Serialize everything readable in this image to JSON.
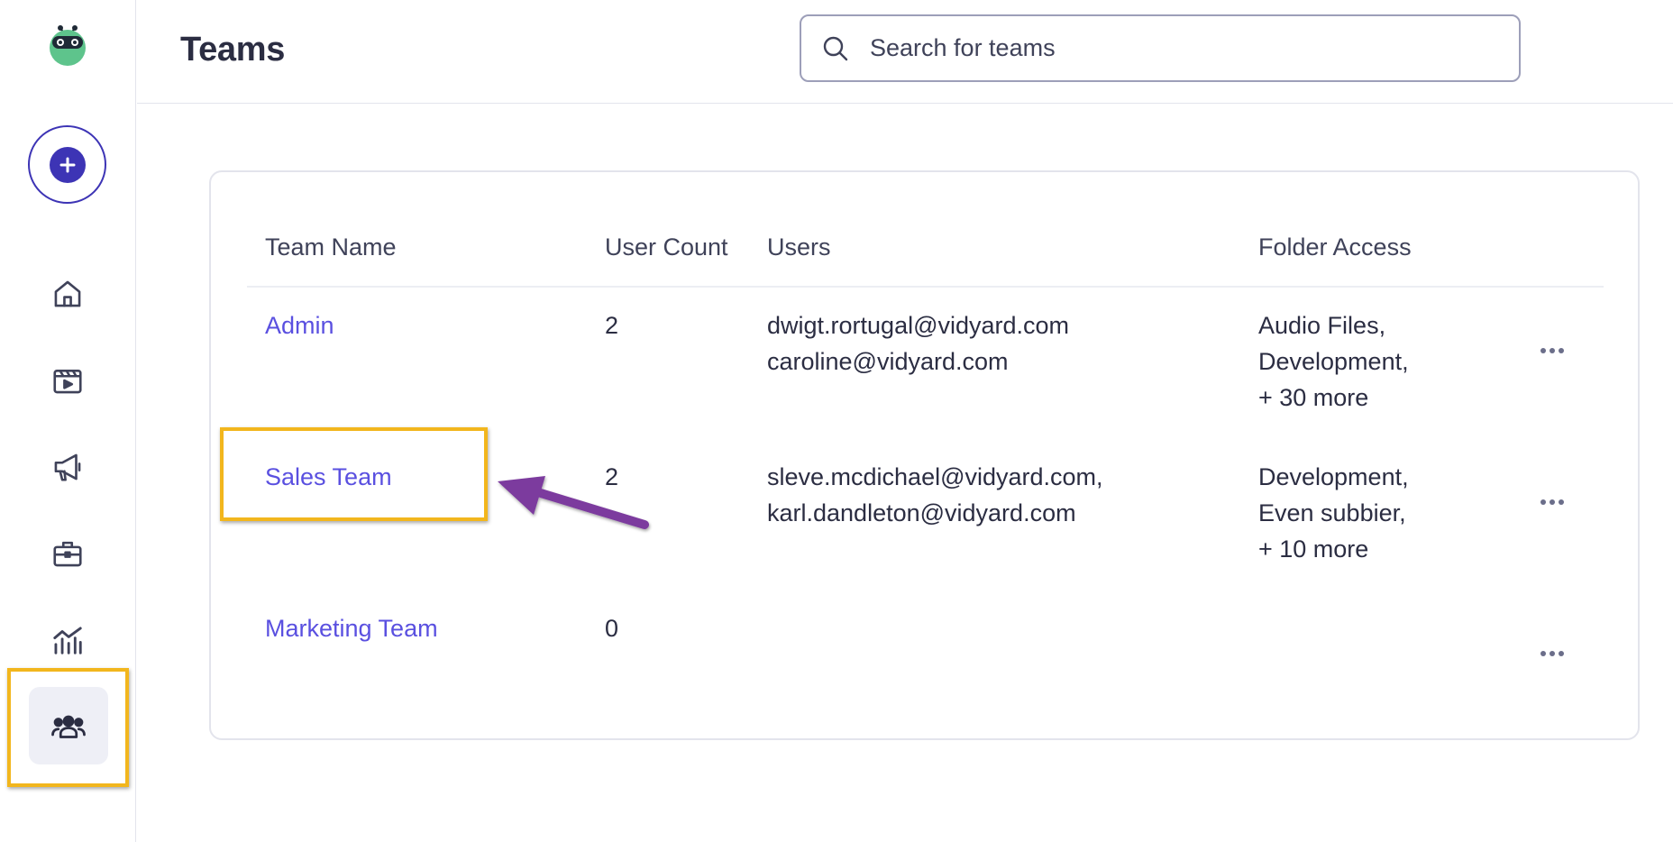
{
  "app": {
    "title": "Teams"
  },
  "search": {
    "placeholder": "Search for teams",
    "value": ""
  },
  "colors": {
    "accent": "#3d34b5",
    "link": "#5a50e0",
    "highlight": "#f2b61d",
    "annotation_arrow": "#7b3a9e"
  },
  "sidebar": {
    "items": [
      {
        "name": "create",
        "icon": "plus-icon"
      },
      {
        "name": "home",
        "icon": "home-icon"
      },
      {
        "name": "videos",
        "icon": "video-library-icon"
      },
      {
        "name": "campaigns",
        "icon": "megaphone-icon"
      },
      {
        "name": "work",
        "icon": "briefcase-icon"
      },
      {
        "name": "analytics",
        "icon": "analytics-icon"
      },
      {
        "name": "teams",
        "icon": "team-icon",
        "active": true
      }
    ]
  },
  "table": {
    "columns": [
      "Team Name",
      "User Count",
      "Users",
      "Folder Access"
    ],
    "rows": [
      {
        "team": "Admin",
        "count": "2",
        "users": [
          "dwigt.rortugal@vidyard.com",
          "caroline@vidyard.com"
        ],
        "folders": [
          "Audio Files,",
          "Development,",
          "+ 30 more"
        ]
      },
      {
        "team": "Sales Team",
        "count": "2",
        "users": [
          "sleve.mcdichael@vidyard.com,",
          "karl.dandleton@vidyard.com"
        ],
        "folders": [
          "Development,",
          "Even subbier,",
          "+ 10 more"
        ]
      },
      {
        "team": "Marketing Team",
        "count": "0",
        "users": [],
        "folders": []
      }
    ]
  }
}
